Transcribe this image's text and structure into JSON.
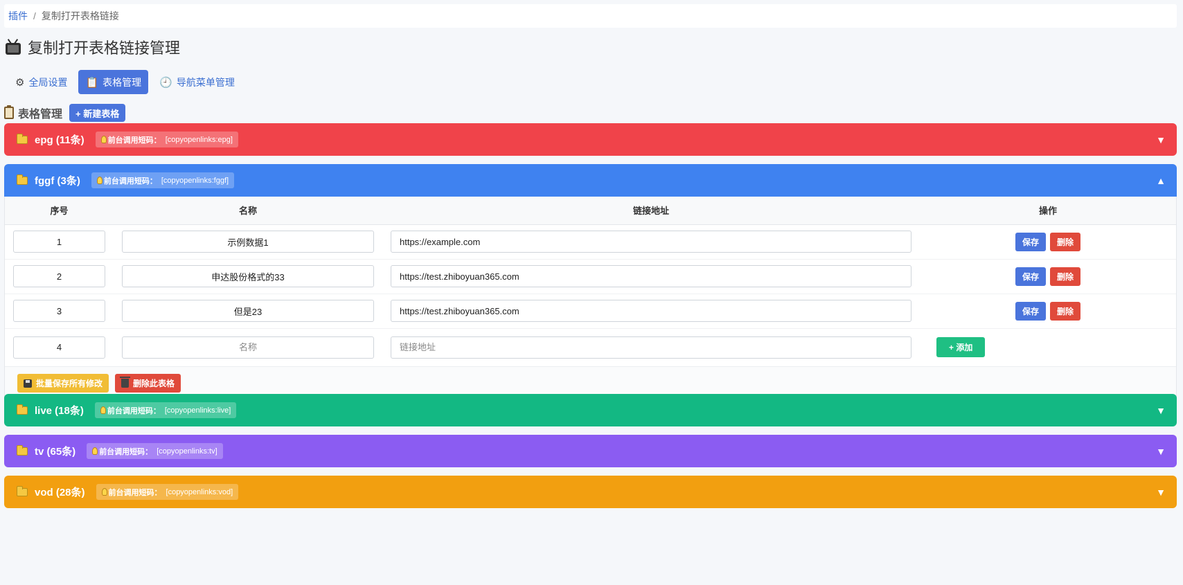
{
  "breadcrumb": {
    "root": "插件",
    "separator": "/",
    "current": "复制打开表格链接"
  },
  "page": {
    "title": "复制打开表格链接管理",
    "icon": "tv-icon"
  },
  "tabs": [
    {
      "label": "全局设置",
      "icon": "gear-icon",
      "active": false
    },
    {
      "label": "表格管理",
      "icon": "clipboard-icon",
      "active": true
    },
    {
      "label": "导航菜单管理",
      "icon": "clock-icon",
      "active": false
    }
  ],
  "section": {
    "title": "表格管理",
    "new_button": "+ 新建表格"
  },
  "badge_label": "前台调用短码：",
  "groups": [
    {
      "name": "epg (11条)",
      "code": "[copyopenlinks:epg]",
      "color": "#f0434a",
      "expanded": false,
      "chevron": "▼"
    },
    {
      "name": "fggf (3条)",
      "code": "[copyopenlinks:fggf]",
      "color": "#3f82f0",
      "expanded": true,
      "chevron": "▲"
    },
    {
      "name": "live (18条)",
      "code": "[copyopenlinks:live]",
      "color": "#13b883",
      "expanded": false,
      "chevron": "▼"
    },
    {
      "name": "tv (65条)",
      "code": "[copyopenlinks:tv]",
      "color": "#8b5cf2",
      "expanded": false,
      "chevron": "▼"
    },
    {
      "name": "vod (28条)",
      "code": "[copyopenlinks:vod]",
      "color": "#f29f10",
      "expanded": false,
      "chevron": "▼"
    }
  ],
  "table": {
    "columns": {
      "index": "序号",
      "name": "名称",
      "url": "链接地址",
      "actions": "操作"
    },
    "rows": [
      {
        "index": "1",
        "name": "示例数据1",
        "url": "https://example.com"
      },
      {
        "index": "2",
        "name": "申达股份格式的33",
        "url": "https://test.zhiboyuan365.com"
      },
      {
        "index": "3",
        "name": "但是23",
        "url": "https://test.zhiboyuan365.com"
      }
    ],
    "new_row": {
      "index": "4",
      "name_placeholder": "名称",
      "url_placeholder": "链接地址"
    },
    "save_label": "保存",
    "delete_label": "删除",
    "add_label": "+ 添加",
    "batch_save_label": "批量保存所有修改",
    "delete_table_label": "删除此表格"
  }
}
